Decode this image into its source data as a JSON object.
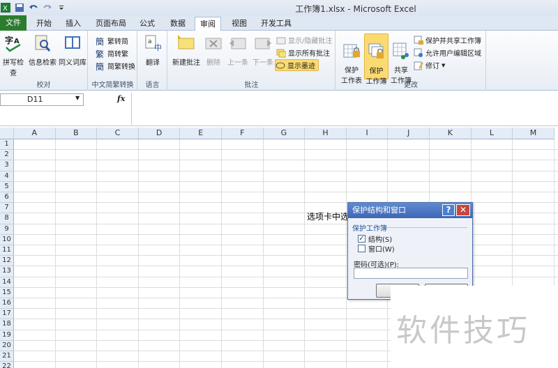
{
  "window": {
    "title": "工作簿1.xlsx - Microsoft Excel"
  },
  "tabs": [
    "文件",
    "开始",
    "插入",
    "页面布局",
    "公式",
    "数据",
    "审阅",
    "视图",
    "开发工具"
  ],
  "active_tab": "审阅",
  "ribbon": {
    "proofing": {
      "label": "校对",
      "spell": "拼写检查",
      "research": "信息检索",
      "thesaurus": "同义词库"
    },
    "chinese": {
      "label": "中文简繁转换",
      "to_simplified": "繁转简",
      "to_traditional": "简转繁",
      "convert": "简繁转换"
    },
    "language": {
      "label": "语言",
      "translate": "翻译"
    },
    "comments": {
      "label": "批注",
      "new": "新建批注",
      "delete": "删除",
      "prev": "上一条",
      "next": "下一条",
      "show_hide": "显示/隐藏批注",
      "show_all": "显示所有批注",
      "show_ink": "显示墨迹"
    },
    "changes": {
      "label": "更改",
      "protect_sheet": "保护\n工作表",
      "protect_workbook": "保护\n工作簿",
      "share_workbook": "共享\n工作簿",
      "protect_share": "保护并共享工作簿",
      "allow_edit": "允许用户编辑区域",
      "track": "修订"
    }
  },
  "formula_bar": {
    "name_box": "D11",
    "fx": "fx",
    "formula": ""
  },
  "grid": {
    "columns": [
      "A",
      "B",
      "C",
      "D",
      "E",
      "F",
      "G",
      "H",
      "I",
      "J",
      "K",
      "L",
      "M"
    ],
    "rows": [
      "1",
      "2",
      "3",
      "4",
      "5",
      "6",
      "7",
      "8",
      "9",
      "10",
      "11",
      "12",
      "13",
      "14",
      "15",
      "16",
      "17",
      "18",
      "19",
      "20",
      "21",
      "22"
    ],
    "cell_text": "选项卡中选"
  },
  "dialog": {
    "title": "保护结构和窗口",
    "help": "?",
    "close": "✕",
    "group_label": "保护工作簿",
    "structure": {
      "label": "结构(S)",
      "checked": true
    },
    "windows": {
      "label": "窗口(W)",
      "checked": false
    },
    "password_label": "密码(可选)(P):",
    "password_value": ""
  },
  "watermark": "软件技巧",
  "colors": {
    "file_tab": "#2b7d2e",
    "dialog_title": "#3d66b4",
    "highlight": "#fbdb71"
  }
}
